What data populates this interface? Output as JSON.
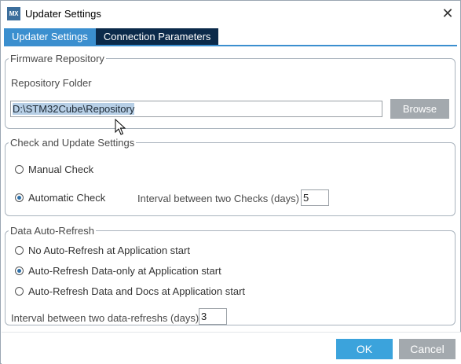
{
  "window": {
    "app_icon_text": "MX",
    "title": "Updater Settings",
    "close_glyph": "✕"
  },
  "tabs": [
    {
      "label": "Updater Settings",
      "active": true
    },
    {
      "label": "Connection Parameters",
      "active": false
    }
  ],
  "firmware_repository": {
    "legend": "Firmware Repository",
    "folder_label": "Repository Folder",
    "folder_value": "D:\\STM32Cube\\Repository",
    "browse_label": "Browse"
  },
  "check_update": {
    "legend": "Check and Update Settings",
    "manual_label": "Manual Check",
    "automatic_label": "Automatic Check",
    "selected": "automatic",
    "interval_label": "Interval between two Checks (days)",
    "interval_value": "5"
  },
  "auto_refresh": {
    "legend": "Data Auto-Refresh",
    "options": [
      {
        "label": "No Auto-Refresh at Application start",
        "checked": false
      },
      {
        "label": "Auto-Refresh Data-only at Application start",
        "checked": true
      },
      {
        "label": "Auto-Refresh Data and Docs at Application start",
        "checked": false
      }
    ],
    "interval_label": "Interval between two data-refreshs (days)",
    "interval_value": "3"
  },
  "footer": {
    "ok_label": "OK",
    "cancel_label": "Cancel"
  },
  "colors": {
    "tab_active": "#3b8fcf",
    "tab_inactive": "#0b2a4a",
    "ok_button": "#3ba3dc",
    "gray_button": "#a3a9ae",
    "selection": "#b7cfe6"
  }
}
